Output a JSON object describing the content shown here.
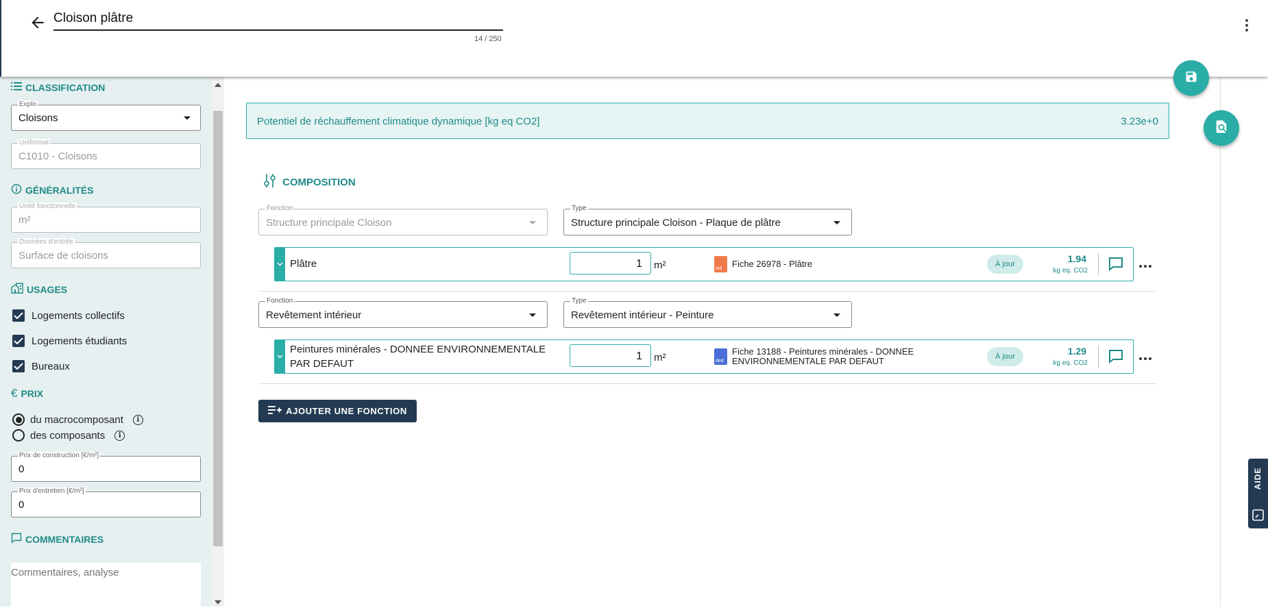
{
  "header": {
    "title": "Cloison plâtre",
    "char_count": "14 / 250"
  },
  "sidebar": {
    "classification": {
      "title": "CLASSIFICATION",
      "explo_label": "Explo",
      "explo_value": "Cloisons",
      "uniformat_label": "Uniformat",
      "uniformat_value": "C1010 - Cloisons"
    },
    "generalites": {
      "title": "GÉNÉRALITÉS",
      "unite_label": "Unité fonctionnelle",
      "unite_value": "m²",
      "donnees_label": "Données d'entrée",
      "donnees_value": "Surface de cloisons"
    },
    "usages": {
      "title": "USAGES",
      "items": [
        {
          "label": "Logements collectifs",
          "checked": true
        },
        {
          "label": "Logements étudiants",
          "checked": true
        },
        {
          "label": "Bureaux",
          "checked": true
        }
      ]
    },
    "prix": {
      "title": "PRIX",
      "options": [
        {
          "label": "du macrocomposant",
          "selected": true
        },
        {
          "label": "des composants",
          "selected": false
        }
      ],
      "construction_label": "Prix de construction [€/m²]",
      "construction_value": "0",
      "entretien_label": "Prix d'entretien [€/m²]",
      "entretien_value": "0"
    },
    "commentaires": {
      "title": "COMMENTAIRES",
      "placeholder": "Commentaires, analyse"
    }
  },
  "banner": {
    "label": "Potentiel de réchauffement climatique dynamique [kg eq CO2]",
    "value": "3.23e+0"
  },
  "composition": {
    "title": "COMPOSITION",
    "functions": [
      {
        "fonction_label": "Fonction",
        "fonction_value": "Structure principale Cloison",
        "type_label": "Type",
        "type_value": "Structure principale Cloison - Plaque de plâtre",
        "component": {
          "name": "Plâtre",
          "quantity": "1",
          "unit": "m²",
          "fiche_badge": "ind",
          "fiche_color": "#f07a4a",
          "fiche": "Fiche 26978 - Plâtre",
          "status": "À jour",
          "co2_value": "1.94",
          "co2_unit": "kg eq. CO2"
        }
      },
      {
        "fonction_label": "Fonction",
        "fonction_value": "Revêtement intérieur",
        "type_label": "Type",
        "type_value": "Revêtement intérieur - Peinture",
        "component": {
          "name": "Peintures minérales - DONNEE ENVIRONNEMENTALE PAR DEFAUT",
          "quantity": "1",
          "unit": "m²",
          "fiche_badge": "ded",
          "fiche_color": "#4a6fd8",
          "fiche": "Fiche 13188 - Peintures minérales - DONNEE ENVIRONNEMENTALE PAR DEFAUT",
          "status": "À jour",
          "co2_value": "1.29",
          "co2_unit": "kg eq. CO2"
        }
      }
    ],
    "add_button": "AJOUTER UNE FONCTION"
  },
  "aide": {
    "label": "AIDE"
  },
  "colors": {
    "accent": "#2aada7",
    "dark": "#233a52",
    "sidebar_bg": "#e6f0f0"
  }
}
